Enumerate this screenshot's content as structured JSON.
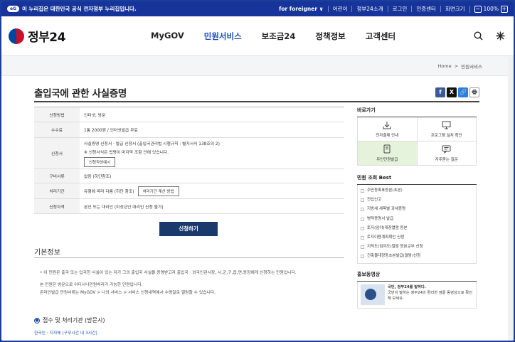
{
  "topbar": {
    "badge": "eG",
    "notice": "이 누리집은 대한민국 공식 전자정부 누리집입니다.",
    "links": [
      "for foreigner ∨",
      "어린이",
      "정부24소개",
      "로그인",
      "인증센터",
      "화면크기"
    ],
    "zoom_minus": "−",
    "zoom_value": "100%",
    "zoom_plus": "+"
  },
  "header": {
    "logo": "정부24",
    "nav": [
      "MyGOV",
      "민원서비스",
      "보조금24",
      "정책정보",
      "고객센터"
    ],
    "active_nav": "민원서비스"
  },
  "breadcrumb": {
    "home": "Home",
    "sep": ">",
    "current": "민원서비스"
  },
  "page": {
    "title": "출입국에 관한 사실증명"
  },
  "share": {
    "facebook": "f",
    "twitter": "X",
    "link": "🔗",
    "print": "🖶"
  },
  "info": {
    "rows": [
      {
        "label": "신청방법",
        "lines": [
          "인터넷, 방문"
        ]
      },
      {
        "label": "수수료",
        "lines": [
          "1통 2000원 / 인터넷발급 무료"
        ]
      },
      {
        "label": "신청서",
        "lines": [
          "사실증명 신청서 · 발급 신청서 (출입국관리법 시행규칙 : 별지서식 138호의 2)",
          "※ 신청서식은 법령이 마지막 조항 안에 있습니다."
        ],
        "button": "신청작성예시"
      },
      {
        "label": "구비서류",
        "lines": [
          "없음 (하단참조)"
        ]
      },
      {
        "label": "처리기간",
        "lines": [
          "유형에 따라 다름 (하단 참조)"
        ],
        "button": "처리기간 계산 방법"
      },
      {
        "label": "신청자격",
        "lines": [
          "본인 또는 대리인 (미성년인 대리인 신청 불가)"
        ]
      }
    ],
    "apply_button": "신청하기"
  },
  "basic": {
    "title": "기본정보",
    "bullet": "이 민원은 출국 또는 입국한 사실이 있는 자가 그의 출입국 사실을 증명받고자 출입국 · 외국인관서장, 시,군,구,읍,면,동장에게 신청하는 민원입니다.",
    "note1": "본 민원은 방문으로 어디서나민원처리가 가능한 민원입니다.",
    "note2": "온라인발급 민원서류는 MyGOV > 나의 서비스 > 서비스 신청내역에서 수령일로 열람할 수 있습니다."
  },
  "receipt": {
    "title": "접수 및 처리기관 (방문시)",
    "office": "한국인 : 지자체 (구무시간 내 3시간)"
  },
  "sidebar": {
    "quick_title": "바로가기",
    "quick": [
      {
        "label": "전자결제 안내",
        "icon": "download-icon"
      },
      {
        "label": "프로그램 설치 확인",
        "icon": "monitor-icon"
      },
      {
        "label": "무인민원발급",
        "icon": "kiosk-icon"
      },
      {
        "label": "자주묻는 질문",
        "icon": "chat-icon"
      }
    ],
    "best_title": "민원 조회 Best",
    "best": [
      "주민등록표등본(초본)",
      "전입신고",
      "지방세 세목별 과세증명",
      "병적증명서 발급",
      "토지(임야)대장열람 등본",
      "토지이용계획확인 신청",
      "지적도(임야도)열람 등본교부 신청",
      "건축물대장등초본발급(열람)신청"
    ],
    "promo_title": "홍보동영상",
    "promo_heading": "국민, 정부24를 말하다.",
    "promo_text": "국민이 말하는 정부24의 편리한 점을 동영상으로 확인해 보세요."
  },
  "colors": {
    "brand": "#16349a",
    "accent": "#1a4fb5",
    "button": "#1a3a6b",
    "facebook": "#3b5998",
    "twitter": "#111111",
    "link": "#2b7de9",
    "print": "#555555"
  }
}
